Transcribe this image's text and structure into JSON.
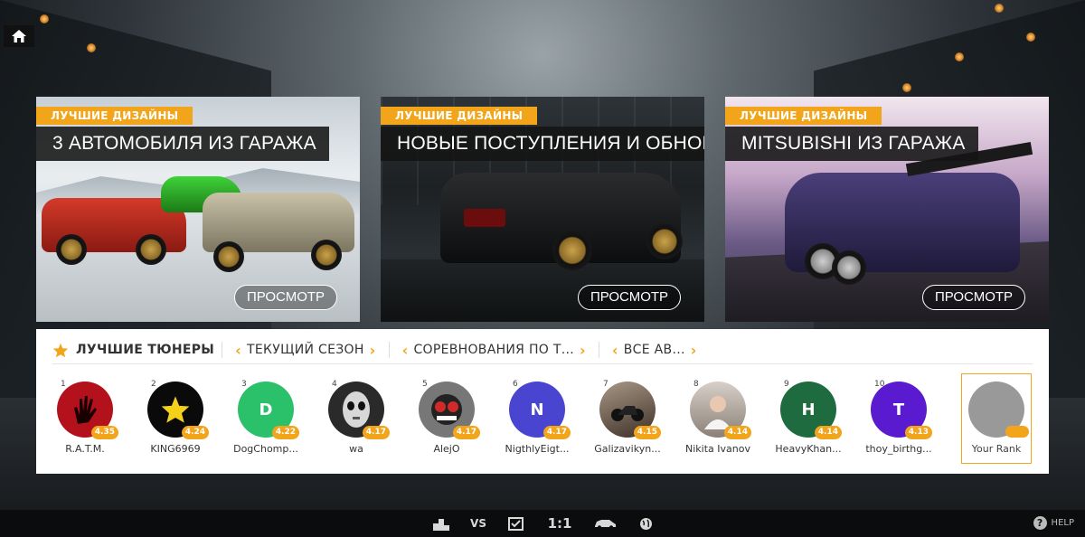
{
  "cards": [
    {
      "tag": "ЛУЧШИЕ ДИЗАЙНЫ",
      "title": "3 АВТОМОБИЛЯ ИЗ ГАРАЖА",
      "button": "ПРОСМОТР"
    },
    {
      "tag": "ЛУЧШИЕ ДИЗАЙНЫ",
      "title": "НОВЫЕ ПОСТУПЛЕНИЯ И ОБНОВЛЕНИЯ",
      "button": "ПРОСМОТР"
    },
    {
      "tag": "ЛУЧШИЕ ДИЗАЙНЫ",
      "title": "MITSUBISHI ИЗ ГАРАЖА",
      "button": "ПРОСМОТР"
    }
  ],
  "leaderboard": {
    "tabs": [
      {
        "label": "ЛУЧШИЕ ТЮНЕРЫ",
        "icon": "star-icon"
      },
      {
        "label": "ТЕКУЩИЙ СЕЗОН"
      },
      {
        "label": "СОРЕВНОВАНИЯ ПО Т..."
      },
      {
        "label": "ВСЕ АВ..."
      }
    ],
    "players": [
      {
        "rank": "1",
        "name": "R.A.T.M.",
        "score": "4.35",
        "color": "#b3121c",
        "initial": ""
      },
      {
        "rank": "2",
        "name": "KING6969",
        "score": "4.24",
        "color": "#0a0a0a",
        "initial": ""
      },
      {
        "rank": "3",
        "name": "DogChomp...",
        "score": "4.22",
        "color": "#2bc06a",
        "initial": "D"
      },
      {
        "rank": "4",
        "name": "wa",
        "score": "4.17",
        "color": "#2a2a2a",
        "initial": ""
      },
      {
        "rank": "5",
        "name": "AlejO",
        "score": "4.17",
        "color": "#777777",
        "initial": ""
      },
      {
        "rank": "6",
        "name": "NigthlyEigt...",
        "score": "4.17",
        "color": "#4a45d0",
        "initial": "N"
      },
      {
        "rank": "7",
        "name": "Galizavikyn...",
        "score": "4.15",
        "color": "#6b5a4a",
        "initial": ""
      },
      {
        "rank": "8",
        "name": "Nikita Ivanov",
        "score": "4.14",
        "color": "#b8b0a8",
        "initial": ""
      },
      {
        "rank": "9",
        "name": "HeavyKhan...",
        "score": "4.14",
        "color": "#1d6b3f",
        "initial": "H"
      },
      {
        "rank": "10",
        "name": "thoy_birthg...",
        "score": "4.13",
        "color": "#5a1bd0",
        "initial": "T"
      }
    ],
    "your_rank_label": "Your Rank"
  },
  "bottom_nav": {
    "items": [
      "podium-icon",
      "vs-icon",
      "checkbox-icon",
      "1:1",
      "car-icon",
      "globe-icon"
    ],
    "help_label": "HELP"
  },
  "colors": {
    "accent": "#f2a51a",
    "panel": "#ffffff",
    "dark_title": "#141414"
  }
}
